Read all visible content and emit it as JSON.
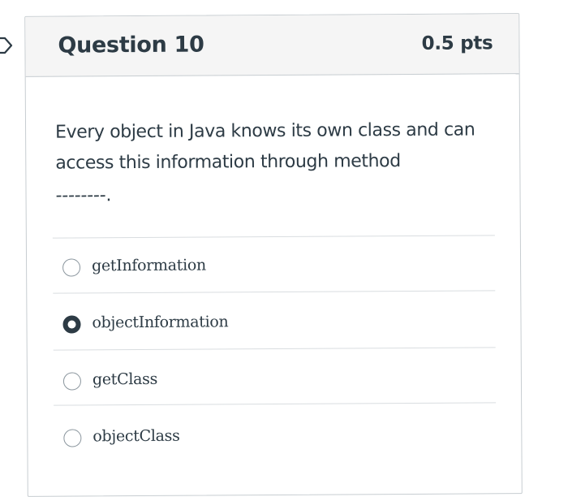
{
  "question": {
    "title": "Question 10",
    "points": "0.5 pts",
    "text": "Every object in Java knows its own class and can access this information through method",
    "blank": "--------."
  },
  "answers": [
    {
      "label": "getInformation",
      "selected": false
    },
    {
      "label": "objectInformation",
      "selected": true
    },
    {
      "label": "getClass",
      "selected": false
    },
    {
      "label": "objectClass",
      "selected": false
    }
  ],
  "colors": {
    "text": "#2d3b45",
    "header_bg": "#f5f5f5",
    "border": "#c7cdd1",
    "divider": "#d9dde0"
  }
}
